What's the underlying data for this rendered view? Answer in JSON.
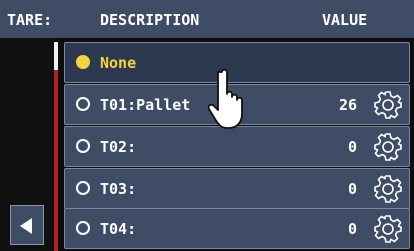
{
  "header": {
    "tare_label": "TARE:",
    "description_label": "DESCRIPTION",
    "value_label": "VALUE"
  },
  "rows": [
    {
      "description": "None",
      "value": "",
      "selected": true
    },
    {
      "description": "T01:Pallet",
      "value": "26"
    },
    {
      "description": "T02:",
      "value": "0"
    },
    {
      "description": "T03:",
      "value": "0"
    },
    {
      "description": "T04:",
      "value": "0"
    }
  ],
  "icons": {
    "back": "left-triangle-icon",
    "settings": "gear-icon",
    "pointer": "pointing-hand-icon"
  },
  "colors": {
    "header_bg": "#3e4c66",
    "row_bg": "#3e4c66",
    "selected_accent": "#f5d442",
    "scroll_track": "#b0202a"
  }
}
